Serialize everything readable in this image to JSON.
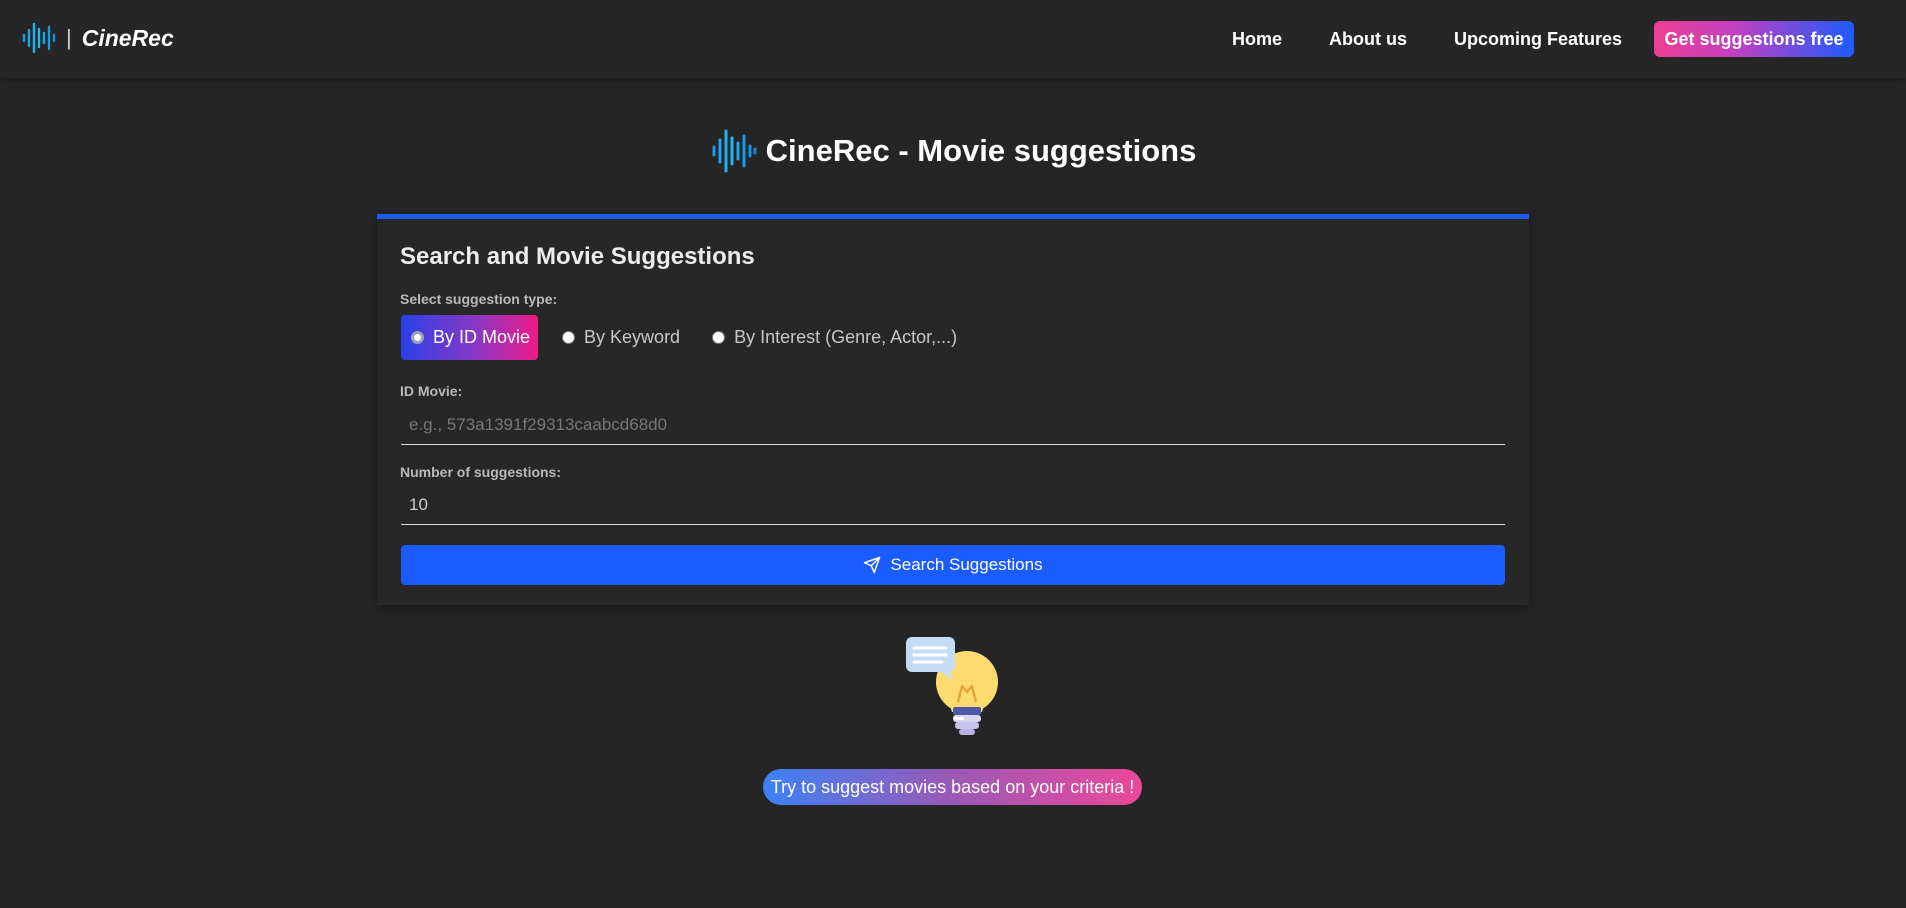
{
  "brand": {
    "name": "CineRec",
    "separator": "|",
    "icon": "sound-wave-logo-icon"
  },
  "nav": {
    "links": [
      "Home",
      "About us",
      "Upcoming Features"
    ],
    "cta_label": "Get suggestions free"
  },
  "page": {
    "title": "CineRec - Movie suggestions"
  },
  "card": {
    "title": "Search and Movie Suggestions",
    "type_label": "Select suggestion type:",
    "options": [
      "By ID Movie",
      "By Keyword",
      "By Interest (Genre, Actor,...)"
    ],
    "selected_option": "By ID Movie",
    "id_label": "ID Movie:",
    "id_placeholder": "e.g., 573a1391f29313caabcd68d0",
    "count_label": "Number of suggestions:",
    "count_value": "10",
    "search_label": "Search Suggestions",
    "search_icon": "send-icon"
  },
  "hint": {
    "text": "Try to suggest movies based on your criteria !",
    "icon": "lightbulb-chat-icon"
  },
  "colors": {
    "background": "#252525",
    "accent_blue": "#1a5cff",
    "accent_pink": "#ec3f93",
    "logo_cyan": "#22b8f0"
  }
}
